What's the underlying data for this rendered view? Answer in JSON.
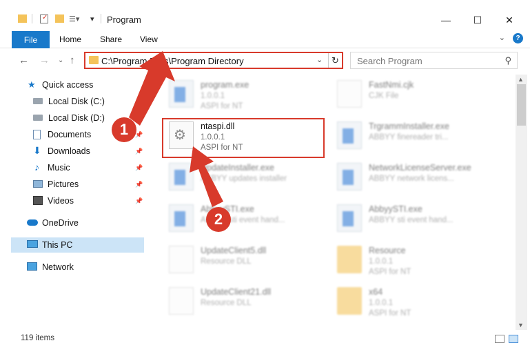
{
  "window": {
    "title": "Program"
  },
  "ribbon": {
    "file": "File",
    "tabs": [
      "Home",
      "Share",
      "View"
    ],
    "help": "?"
  },
  "address": {
    "path": "C:\\Program Files\\Program Directory"
  },
  "search": {
    "placeholder": "Search Program"
  },
  "sidebar": {
    "items": [
      {
        "label": "Quick access",
        "icon": "star-icon"
      },
      {
        "label": "Local Disk (C:)",
        "icon": "drive-icon"
      },
      {
        "label": "Local Disk (D:)",
        "icon": "drive-icon"
      },
      {
        "label": "Documents",
        "icon": "documents-icon"
      },
      {
        "label": "Downloads",
        "icon": "download-icon"
      },
      {
        "label": "Music",
        "icon": "music-icon"
      },
      {
        "label": "Pictures",
        "icon": "pictures-icon"
      },
      {
        "label": "Videos",
        "icon": "videos-icon"
      },
      {
        "label": "OneDrive",
        "icon": "cloud-icon"
      },
      {
        "label": "This PC",
        "icon": "computer-icon"
      },
      {
        "label": "Network",
        "icon": "network-icon"
      }
    ]
  },
  "files": [
    {
      "name": "program.exe",
      "version": "1.0.0.1",
      "desc": "ASPI for NT"
    },
    {
      "name": "FastNmi.cjk",
      "version": "",
      "desc": "CJK File"
    },
    {
      "name": "ntaspi.dll",
      "version": "1.0.0.1",
      "desc": "ASPI for NT"
    },
    {
      "name": "TrgrammInstaller.exe",
      "version": "",
      "desc": "ABBYY finereader tri..."
    },
    {
      "name": "UpdateInstaller.exe",
      "version": "",
      "desc": "ABBYY updates installer"
    },
    {
      "name": "NetworkLicenseServer.exe",
      "version": "",
      "desc": "ABBYY network licens..."
    },
    {
      "name": "AbbyySTI.exe",
      "version": "",
      "desc": "ABBYY sti event hand..."
    },
    {
      "name": "AbbyySTI.exe",
      "version": "",
      "desc": "ABBYY sti event hand..."
    },
    {
      "name": "UpdateClient5.dll",
      "version": "",
      "desc": "Resource DLL"
    },
    {
      "name": "Resource",
      "version": "1.0.0.1",
      "desc": "ASPI for NT"
    },
    {
      "name": "UpdateClient21.dll",
      "version": "",
      "desc": "Resource DLL"
    },
    {
      "name": "x64",
      "version": "1.0.0.1",
      "desc": "ASPI for NT"
    }
  ],
  "status": {
    "items": "119 items"
  },
  "markers": [
    "1",
    "2"
  ],
  "colors": {
    "accent": "#1979ca",
    "annotation": "#d83a2b",
    "selection": "#cce4f7"
  }
}
